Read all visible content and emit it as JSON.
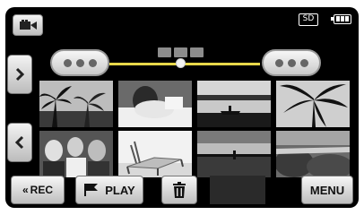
{
  "status": {
    "media_label": "SD"
  },
  "page_indicator": {
    "count": 3,
    "current": 2
  },
  "thumbnails": [
    {
      "scene": "palm trees silhouette"
    },
    {
      "scene": "person reading on bed"
    },
    {
      "scene": "boat on lake at dusk"
    },
    {
      "scene": "palm leaves silhouette"
    },
    {
      "scene": "group of people"
    },
    {
      "scene": "beach lounge chair"
    },
    {
      "scene": "person on shore"
    },
    {
      "scene": "rocky shore"
    }
  ],
  "toolbar": {
    "rec_label": "REC",
    "play_label": "PLAY",
    "menu_label": "MENU"
  },
  "colors": {
    "slider_track": "#e8d84a",
    "screen_bg": "#000000"
  }
}
